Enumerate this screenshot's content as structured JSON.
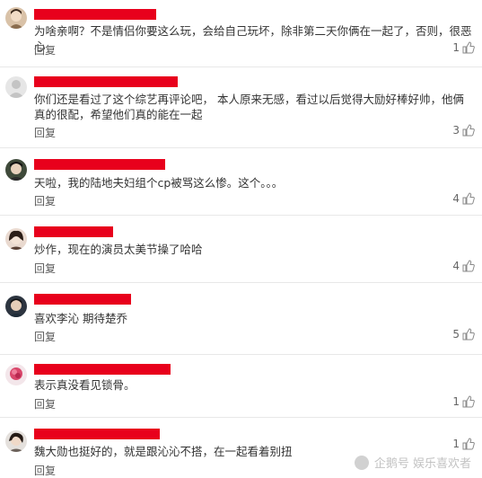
{
  "comments": [
    {
      "text": "为啥亲啊？不是情侣你要这么玩，会给自己玩坏，除非第二天你俩在一起了，否则，很恶心",
      "reply": "回复",
      "likes": "1"
    },
    {
      "text": "你们还是看过了这个综艺再评论吧， 本人原来无感，看过以后觉得大励好棒好帅，他俩真的很配，希望他们真的能在一起",
      "reply": "回复",
      "likes": "3"
    },
    {
      "text": "天啦，我的陆地夫妇组个cp被骂这么惨。这个。。。",
      "reply": "回复",
      "likes": "4"
    },
    {
      "text": "炒作，现在的演员太美节操了哈哈",
      "reply": "回复",
      "likes": "4"
    },
    {
      "text": "喜欢李沁 期待楚乔",
      "reply": "回复",
      "likes": "5"
    },
    {
      "text": "表示真没看见锁骨。",
      "reply": "回复",
      "likes": "1"
    },
    {
      "text": "魏大勋也挺好的，就是跟沁沁不搭，在一起看着别扭",
      "reply": "回复",
      "likes": "1"
    }
  ],
  "icons": {
    "like": "thumbs-up-icon"
  },
  "watermark": {
    "text": "企鹅号 娱乐喜欢者"
  },
  "colors": {
    "redaction": "#e8001c",
    "text": "#333333",
    "reply": "#5a5a5a",
    "divider": "#e8e8e8"
  }
}
